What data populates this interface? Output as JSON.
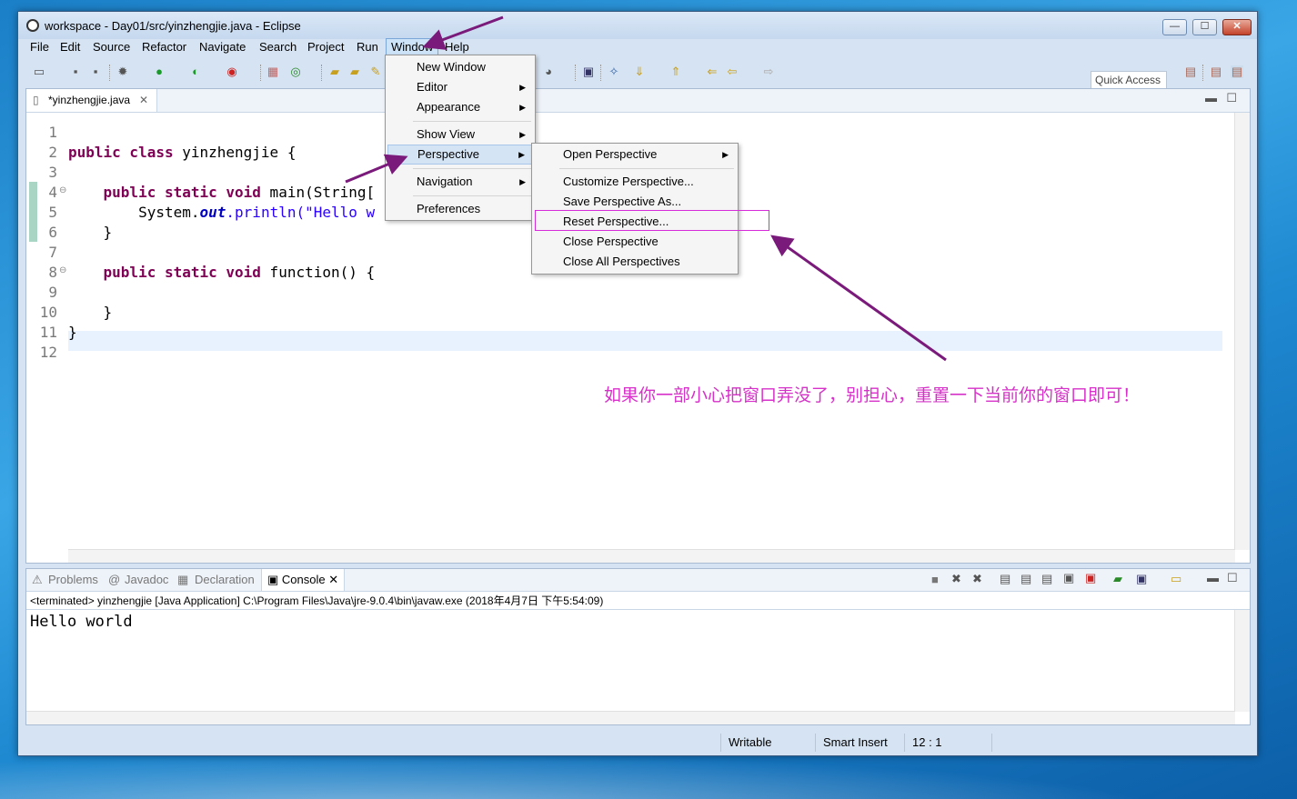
{
  "window": {
    "title": "workspace - Day01/src/yinzhengjie.java - Eclipse",
    "controls": {
      "minimize": "—",
      "maximize": "☐",
      "close": "✕"
    }
  },
  "menubar": [
    "File",
    "Edit",
    "Source",
    "Refactor",
    "Navigate",
    "Search",
    "Project",
    "Run",
    "Window",
    "Help"
  ],
  "toolbar": {
    "quick_access": "Quick Access"
  },
  "editor": {
    "tab_label": "*yinzhengjie.java",
    "line_numbers": [
      "1",
      "2",
      "3",
      "4",
      "5",
      "6",
      "7",
      "8",
      "9",
      "10",
      "11",
      "12"
    ],
    "code": {
      "l2": [
        "public class",
        " yinzhengjie {"
      ],
      "l4": [
        "    public static void",
        " main(String["
      ],
      "l5": [
        "        System.",
        "out",
        ".println(\"Hello w"
      ],
      "l6": "    }",
      "l8": [
        "    public static void",
        " function() {"
      ],
      "l10": "    }",
      "l11": "}"
    }
  },
  "window_menu": {
    "items": [
      "New Window",
      "Editor",
      "Appearance",
      "Show View",
      "Perspective",
      "Navigation",
      "Preferences"
    ]
  },
  "perspective_menu": {
    "items": [
      "Open Perspective",
      "Customize Perspective...",
      "Save Perspective As...",
      "Reset Perspective...",
      "Close Perspective",
      "Close All Perspectives"
    ]
  },
  "console": {
    "tabs": [
      "Problems",
      "Javadoc",
      "Declaration",
      "Console"
    ],
    "info": "<terminated> yinzhengjie [Java Application] C:\\Program Files\\Java\\jre-9.0.4\\bin\\javaw.exe (2018年4月7日 下午5:54:09)",
    "output": "Hello world"
  },
  "statusbar": {
    "writable": "Writable",
    "insert_mode": "Smart Insert",
    "position": "12 : 1"
  },
  "annotation": "如果你一部小心把窗口弄没了，别担心，重置一下当前你的窗口即可！",
  "colors": {
    "annotation": "#d631c8",
    "arrow": "#7a1a7a",
    "keyword": "#7f0055",
    "string": "#2a00ff"
  }
}
